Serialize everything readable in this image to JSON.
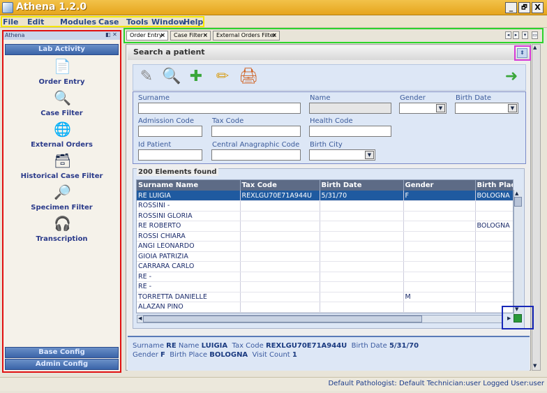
{
  "app": {
    "title": "Athena 1.2.0",
    "win_min": "_",
    "win_max": "🗗",
    "win_close": "X"
  },
  "menu": [
    "File",
    "Edit",
    "Modules",
    "Case",
    "Tools",
    "Window",
    "Help"
  ],
  "sidebar": {
    "header": "Athena",
    "header_controls": "◧ ✕",
    "section": "Lab Activity",
    "items": [
      {
        "label": "Order Entry",
        "icon": "📄"
      },
      {
        "label": "Case Filter",
        "icon": "🔍"
      },
      {
        "label": "External Orders",
        "icon": "🌐"
      },
      {
        "label": "Historical Case Filter",
        "icon": "🗃"
      },
      {
        "label": "Specimen Filter",
        "icon": "🔎"
      },
      {
        "label": "Transcription",
        "icon": "🎧"
      }
    ],
    "base_config": "Base Config",
    "admin_config": "Admin Config"
  },
  "tabs": [
    {
      "label": "Order Entry",
      "close": "×"
    },
    {
      "label": "Case Filter",
      "close": "×"
    },
    {
      "label": "External Orders Filter",
      "close": "×"
    }
  ],
  "tab_nav": [
    "◂",
    "▸",
    "▾",
    "▭"
  ],
  "search": {
    "title": "Search a patient",
    "toggle": "⬍",
    "tools": [
      {
        "name": "eraser-icon",
        "glyph": "✎"
      },
      {
        "name": "search-icon",
        "glyph": "🔍"
      },
      {
        "name": "add-icon",
        "glyph": "✚"
      },
      {
        "name": "pencil-icon",
        "glyph": "✏"
      },
      {
        "name": "print-icon",
        "glyph": "🖨"
      }
    ],
    "go_icon": "➜"
  },
  "form": {
    "surname": "Surname",
    "name": "Name",
    "gender": "Gender",
    "birth_date": "Birth Date",
    "admission_code": "Admission Code",
    "tax_code": "Tax Code",
    "health_code": "Health Code",
    "id_patient": "Id Patient",
    "central_code": "Central Anagraphic Code",
    "birth_city": "Birth City",
    "arrow": "▼"
  },
  "results": {
    "title": "200 Elements found",
    "columns": [
      "Surname Name",
      "Tax Code",
      "Birth Date",
      "Gender",
      "Birth Place"
    ],
    "rows": [
      [
        "RE LUIGIA",
        "REXLGU70E71A944U",
        "5/31/70",
        "F",
        "BOLOGNA"
      ],
      [
        "ROSSINI -",
        "",
        "",
        "",
        ""
      ],
      [
        "ROSSINI GLORIA",
        "",
        "",
        "",
        ""
      ],
      [
        "RE ROBERTO",
        "",
        "",
        "",
        "BOLOGNA"
      ],
      [
        "ROSSI CHIARA",
        "",
        "",
        "",
        ""
      ],
      [
        "ANGI LEONARDO",
        "",
        "",
        "",
        ""
      ],
      [
        "GIOIA PATRIZIA",
        "",
        "",
        "",
        ""
      ],
      [
        "CARRARA CARLO",
        "",
        "",
        "",
        ""
      ],
      [
        "RE -",
        "",
        "",
        "",
        ""
      ],
      [
        "RE -",
        "",
        "",
        "",
        ""
      ],
      [
        "TORRETTA DANIELLE",
        "",
        "",
        "M",
        ""
      ],
      [
        "ALAZAN PINO",
        "",
        "",
        "",
        ""
      ]
    ]
  },
  "detail": {
    "surname_label": "Surname",
    "surname": "RE",
    "name_label": "Name",
    "name": "LUIGIA",
    "tax_label": "Tax Code",
    "tax": "REXLGU70E71A944U",
    "birth_label": "Birth Date",
    "birth": "5/31/70",
    "gender_label": "Gender",
    "gender": "F",
    "place_label": "Birth Place",
    "place": "BOLOGNA",
    "visit_label": "Visit Count",
    "visit": "1"
  },
  "status": "Default Pathologist: Default Technician:user Logged User:user"
}
